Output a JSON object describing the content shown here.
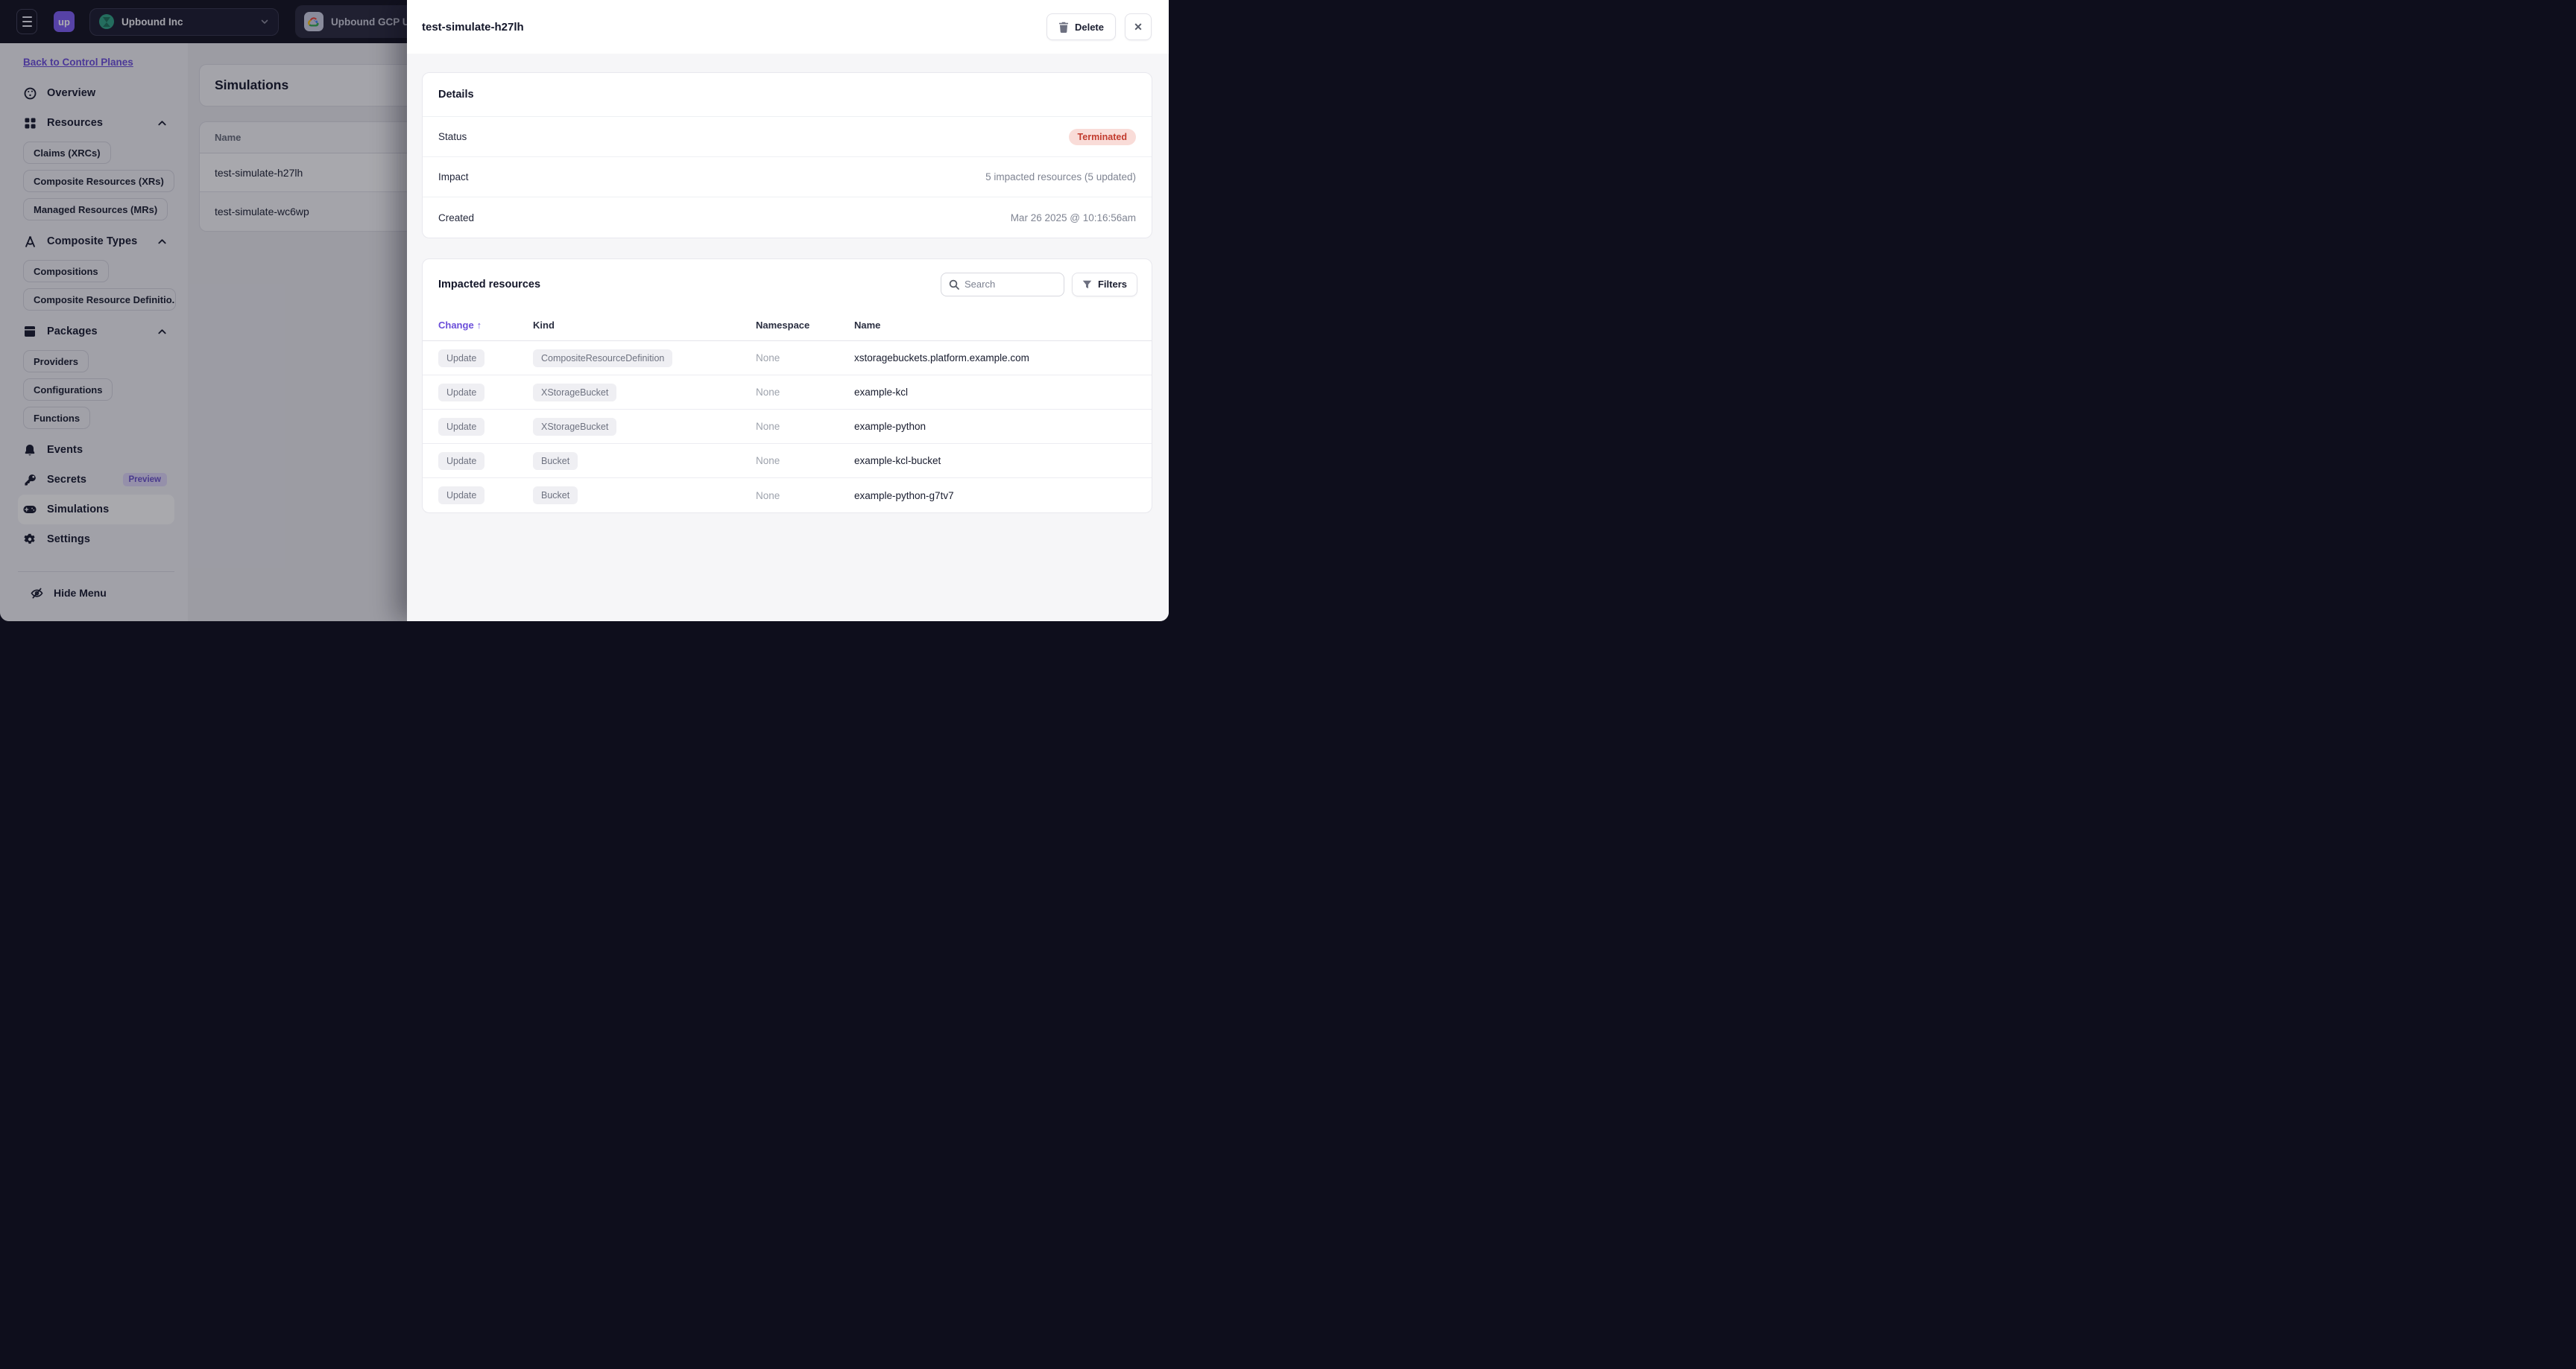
{
  "topbar": {
    "logo_text": "up",
    "org_name": "Upbound Inc",
    "control_plane_tab": "Upbound GCP U"
  },
  "sidebar": {
    "back_link": "Back to Control Planes",
    "items": [
      {
        "label": "Overview"
      },
      {
        "label": "Resources"
      },
      {
        "label": "Claims (XRCs)"
      },
      {
        "label": "Composite Resources (XRs)"
      },
      {
        "label": "Managed Resources (MRs)"
      },
      {
        "label": "Composite Types"
      },
      {
        "label": "Compositions"
      },
      {
        "label": "Composite Resource Definitio..."
      },
      {
        "label": "Packages"
      },
      {
        "label": "Providers"
      },
      {
        "label": "Configurations"
      },
      {
        "label": "Functions"
      },
      {
        "label": "Events"
      },
      {
        "label": "Secrets",
        "badge": "Preview"
      },
      {
        "label": "Simulations",
        "selected": true
      },
      {
        "label": "Settings"
      }
    ],
    "hide_menu": "Hide Menu"
  },
  "main": {
    "title": "Simulations",
    "table": {
      "name_header": "Name",
      "rows": [
        {
          "name": "test-simulate-h27lh"
        },
        {
          "name": "test-simulate-wc6wp"
        }
      ]
    }
  },
  "panel": {
    "title": "test-simulate-h27lh",
    "delete_button": "Delete",
    "close_glyph": "✕",
    "details": {
      "heading": "Details",
      "rows": [
        {
          "label": "Status",
          "value": "Terminated"
        },
        {
          "label": "Impact",
          "value": "5 impacted resources (5 updated)"
        },
        {
          "label": "Created",
          "value": "Mar 26 2025 @ 10:16:56am"
        }
      ]
    },
    "impacted": {
      "heading": "Impacted resources",
      "search_placeholder": "Search",
      "filters_button": "Filters",
      "columns": [
        "Change",
        "Kind",
        "Namespace",
        "Name"
      ],
      "sort": {
        "column": "Change",
        "direction": "asc",
        "indicator": "↑"
      },
      "rows": [
        {
          "change": "Update",
          "kind": "CompositeResourceDefinition",
          "namespace": "None",
          "name": "xstoragebuckets.platform.example.com"
        },
        {
          "change": "Update",
          "kind": "XStorageBucket",
          "namespace": "None",
          "name": "example-kcl"
        },
        {
          "change": "Update",
          "kind": "XStorageBucket",
          "namespace": "None",
          "name": "example-python"
        },
        {
          "change": "Update",
          "kind": "Bucket",
          "namespace": "None",
          "name": "example-kcl-bucket"
        },
        {
          "change": "Update",
          "kind": "Bucket",
          "namespace": "None",
          "name": "example-python-g7tv7"
        }
      ]
    }
  },
  "colors": {
    "accent_purple": "#6b4ed9",
    "status_terminated_bg": "#f9dcd8",
    "status_terminated_text": "#c23b2e",
    "topbar_bg": "#12121f",
    "logo_bg": "#7c5cf0"
  }
}
